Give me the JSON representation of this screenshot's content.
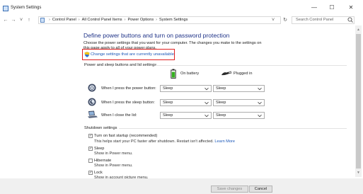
{
  "window": {
    "title": "System Settings",
    "minimize": "—",
    "maximize": "☐",
    "close": "✕"
  },
  "address": {
    "back": "←",
    "forward": "→",
    "recent": "˅",
    "up": "↑",
    "crumbs": [
      "Control Panel",
      "All Control Panel Items",
      "Power Options",
      "System Settings"
    ],
    "dropdown": "˅",
    "refresh": "↻",
    "search_placeholder": "Search Control Panel"
  },
  "main": {
    "heading": "Define power buttons and turn on password protection",
    "description": "Choose the power settings that you want for your computer. The changes you make to the settings on this page apply to all of your power plans.",
    "change_link": "Change settings that are currently unavailable"
  },
  "power_section": {
    "title": "Power and sleep buttons and lid settings",
    "col_battery": "On battery",
    "col_plugged": "Plugged in",
    "rows": [
      {
        "label": "When I press the power button:",
        "battery": "Sleep",
        "plugged": "Sleep"
      },
      {
        "label": "When I press the sleep button:",
        "battery": "Sleep",
        "plugged": "Sleep"
      },
      {
        "label": "When I close the lid:",
        "battery": "Sleep",
        "plugged": "Sleep"
      }
    ]
  },
  "shutdown": {
    "title": "Shutdown settings",
    "items": [
      {
        "label": "Turn on fast startup (recommended)",
        "sub": "This helps start your PC faster after shutdown. Restart isn't affected.",
        "link": "Learn More",
        "checked": true,
        "mark": "✓"
      },
      {
        "label": "Sleep",
        "sub": "Show in Power menu.",
        "checked": true,
        "mark": "✓"
      },
      {
        "label": "Hibernate",
        "sub": "Show in Power menu.",
        "checked": false,
        "mark": ""
      },
      {
        "label": "Lock",
        "sub": "Show in account picture menu.",
        "checked": true,
        "mark": "✓"
      }
    ]
  },
  "footer": {
    "save": "Save changes",
    "cancel": "Cancel"
  },
  "colors": {
    "heading": "#1e3287",
    "link": "#1a57b8",
    "highlight_box": "#e02020"
  }
}
